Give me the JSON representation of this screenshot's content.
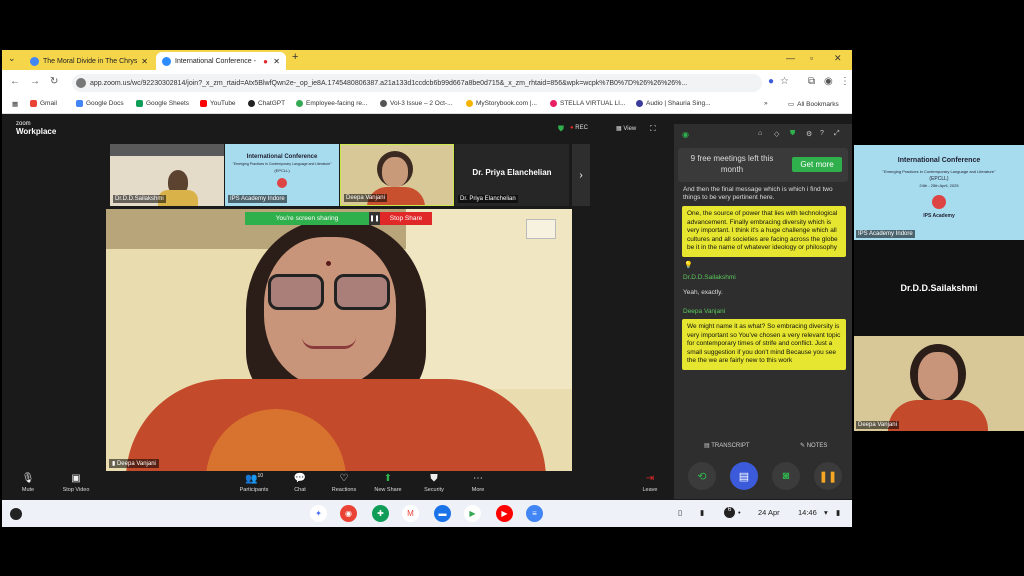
{
  "browser": {
    "tabs": [
      {
        "label": "The Moral Divide in The Chrys",
        "active": false
      },
      {
        "label": "International Conference -",
        "active": true
      }
    ],
    "new_tab": "+",
    "url": "app.zoom.us/wc/92230302814/join?_x_zm_rtaid=Atx5BlwfQwn2e-_op_ie8A.1745480806387.a21a133d1ccdcb6b99d667a8be0d715&_x_zm_rhtaid=856&wpk=wcpk%7B0%7D%26%26%26%...",
    "bookmarks": [
      "Gmail",
      "Google Docs",
      "Google Sheets",
      "YouTube",
      "ChatGPT",
      "Employee-facing re...",
      "Vol-3 Issue – 2 Oct-...",
      "MyStorybook.com |...",
      "STELLA VIRTUAL LI...",
      "Audio | Shauria Sing...",
      "All Bookmarks"
    ]
  },
  "zoom": {
    "logo_top": "zoom",
    "logo_bottom": "Workplace",
    "rec": "REC",
    "view": "View",
    "participants": [
      {
        "name": "Dr.D.D.Sailakshmi"
      },
      {
        "name": "IPS Academy Indore"
      },
      {
        "name": "Deepa Vanjani"
      },
      {
        "name": "Dr. Priya Elanchelian"
      }
    ],
    "featured_name": "Dr. Priya Elanchelian",
    "main_label": "Deepa Vanjani",
    "share_banner": "You're screen sharing",
    "stop_share": "Stop Share",
    "toolbar": {
      "mute": "Mute",
      "stop_video": "Stop Video",
      "participants": "Participants",
      "participants_count": "10",
      "chat": "Chat",
      "reactions": "Reactions",
      "new_share": "New Share",
      "security": "Security",
      "more": "More",
      "leave": "Leave"
    },
    "slide": {
      "title": "International Conference",
      "subtitle": "\"Emerging Practices in Contemporary Language and Literature\"",
      "acronym": "(EPCLL)",
      "date": "24th - 25th April, 2025",
      "org": "IPS Academy"
    }
  },
  "panel": {
    "promo_text": "9 free meetings left this month",
    "promo_button": "Get more",
    "transcript": [
      {
        "type": "plain",
        "text": "And then the final message which is which i find two things to be very pertinent here."
      },
      {
        "type": "highlight",
        "text": "One, the source of power that lies with technological advancement. Finally embracing diversity which is very important. I think it's a huge challenge which all cultures and all societies are facing across the globe be it in the name of whatever ideology or philosophy"
      },
      {
        "type": "speaker",
        "text": "Dr.D.D.Sailakshmi"
      },
      {
        "type": "plain",
        "text": "Yeah, exactly."
      },
      {
        "type": "speaker",
        "text": "Deepa Vanjani"
      },
      {
        "type": "highlight",
        "text": "We might name it as what? So embracing diversity is very important so You've chosen a very relevant topic for contemporary times of strife and conflict. Just a small suggestion if you don't mind Because you see the the we are fairly new to this work"
      }
    ],
    "tab_transcript": "TRANSCRIPT",
    "tab_notes": "NOTES"
  },
  "right": {
    "slide_label": "IPS Academy Indore",
    "name": "Dr.D.D.Sailakshmi",
    "video_label": "Deepa Vanjani"
  },
  "taskbar": {
    "date": "24 Apr",
    "time": "14:46"
  }
}
